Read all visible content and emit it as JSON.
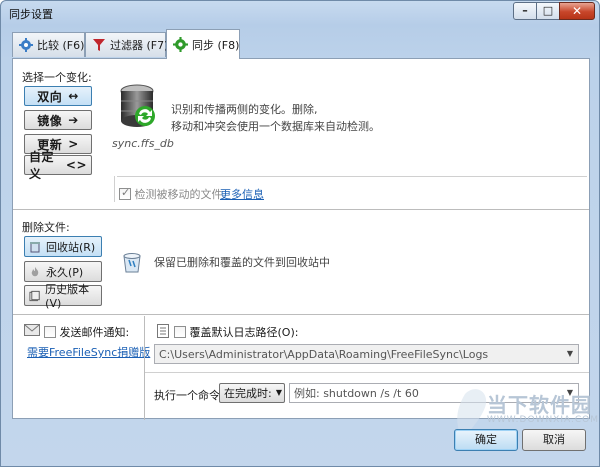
{
  "window": {
    "title": "同步设置"
  },
  "tabs": [
    {
      "label": "比较 (F6)",
      "icon": "gear-blue-icon"
    },
    {
      "label": "过滤器 (F7)",
      "icon": "filter-icon"
    },
    {
      "label": "同步 (F8)",
      "icon": "gear-green-icon",
      "active": true
    }
  ],
  "variant": {
    "section_label": "选择一个变化:",
    "buttons": [
      {
        "label": "双向",
        "arrow": "↔",
        "selected": true
      },
      {
        "label": "镜像",
        "arrow": "➔"
      },
      {
        "label": "更新",
        "arrow": ">"
      },
      {
        "label": "自定义",
        "arrow": "<>"
      }
    ],
    "db_caption": "sync.ffs_db",
    "description_line1": "识别和传播两侧的变化。删除,",
    "description_line2": "移动和冲突会使用一个数据库来自动检测。",
    "detect_moved_label": "检测被移动的文件",
    "more_info_link": "更多信息"
  },
  "deletion": {
    "section_label": "删除文件:",
    "buttons": [
      {
        "label": "回收站(R)",
        "selected": true
      },
      {
        "label": "永久(P)"
      },
      {
        "label": "历史版本(V)"
      }
    ],
    "description": "保留已删除和覆盖的文件到回收站中"
  },
  "email": {
    "label": "发送邮件通知:",
    "link": "需要FreeFileSync捐赠版"
  },
  "log": {
    "override_label": "覆盖默认日志路径(O):",
    "path_value": "C:\\Users\\Administrator\\AppData\\Roaming\\FreeFileSync\\Logs"
  },
  "command": {
    "label": "执行一个命令:",
    "when_value": "在完成时:",
    "placeholder": "例如: shutdown /s /t 60"
  },
  "footer": {
    "ok_label": "确定",
    "cancel_label": "取消"
  },
  "watermark": {
    "text": "当下软件园",
    "sub": "WWW.DOWNXIA.COM"
  }
}
